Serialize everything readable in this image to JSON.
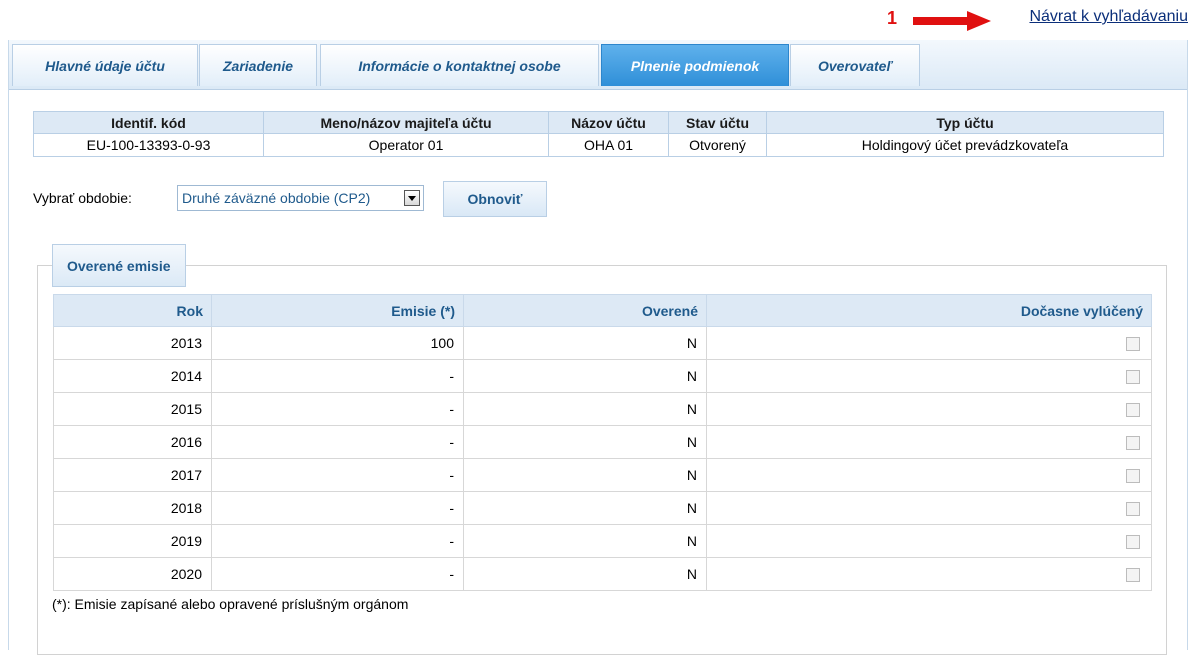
{
  "header": {
    "marker": "1",
    "back_link": "Návrat k vyhľadávaniu",
    "accent_color": "#e01010"
  },
  "tabs": [
    {
      "label": "Hlavné údaje účtu",
      "active": false
    },
    {
      "label": "Zariadenie",
      "active": false
    },
    {
      "label": "Informácie o kontaktnej osobe",
      "active": false
    },
    {
      "label": "Plnenie podmienok",
      "active": true
    },
    {
      "label": "Overovateľ",
      "active": false
    }
  ],
  "account": {
    "headers": [
      "Identif. kód",
      "Meno/názov majiteľa účtu",
      "Názov účtu",
      "Stav účtu",
      "Typ účtu"
    ],
    "row": [
      "EU-100-13393-0-93",
      "Operator 01",
      "OHA 01",
      "Otvorený",
      "Holdingový účet prevádzkovateľa"
    ]
  },
  "period": {
    "label": "Vybrať obdobie:",
    "selected": "Druhé záväzné obdobie (CP2)",
    "refresh_button": "Obnoviť"
  },
  "emissions": {
    "title": "Overené emisie",
    "headers": [
      "Rok",
      "Emisie (*)",
      "Overené",
      "Dočasne vylúčený"
    ],
    "rows": [
      {
        "year": "2013",
        "emissions": "100",
        "verified": "N"
      },
      {
        "year": "2014",
        "emissions": "-",
        "verified": "N"
      },
      {
        "year": "2015",
        "emissions": "-",
        "verified": "N"
      },
      {
        "year": "2016",
        "emissions": "-",
        "verified": "N"
      },
      {
        "year": "2017",
        "emissions": "-",
        "verified": "N"
      },
      {
        "year": "2018",
        "emissions": "-",
        "verified": "N"
      },
      {
        "year": "2019",
        "emissions": "-",
        "verified": "N"
      },
      {
        "year": "2020",
        "emissions": "-",
        "verified": "N"
      }
    ],
    "footnote": "(*): Emisie zapísané alebo opravené príslušným orgánom"
  }
}
